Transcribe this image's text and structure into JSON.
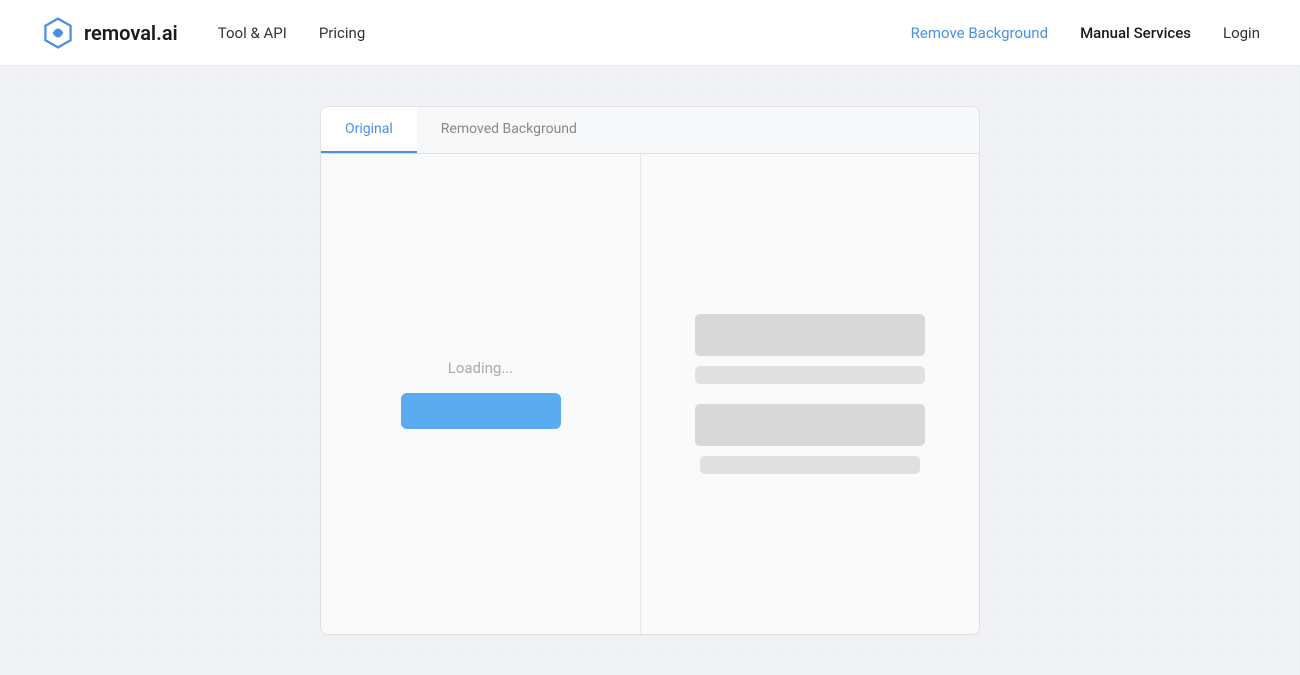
{
  "brand": {
    "logo_text": "removal.ai",
    "logo_alt": "removal.ai logo"
  },
  "navbar": {
    "left_links": [
      {
        "label": "Tool & API",
        "id": "tool-api"
      },
      {
        "label": "Pricing",
        "id": "pricing"
      }
    ],
    "right_links": [
      {
        "label": "Remove Background",
        "id": "remove-bg",
        "active": true
      },
      {
        "label": "Manual Services",
        "id": "manual-services"
      },
      {
        "label": "Login",
        "id": "login"
      }
    ]
  },
  "tabs": [
    {
      "label": "Original",
      "active": true
    },
    {
      "label": "Removed Background",
      "active": false
    }
  ],
  "left_panel": {
    "loading_text": "Loading...",
    "button_label": ""
  },
  "colors": {
    "active_link": "#4a90e2",
    "loading_bar": "#5aabf0",
    "skeleton_dark": "#d8d8d8",
    "skeleton_light": "#e0e0e0"
  }
}
